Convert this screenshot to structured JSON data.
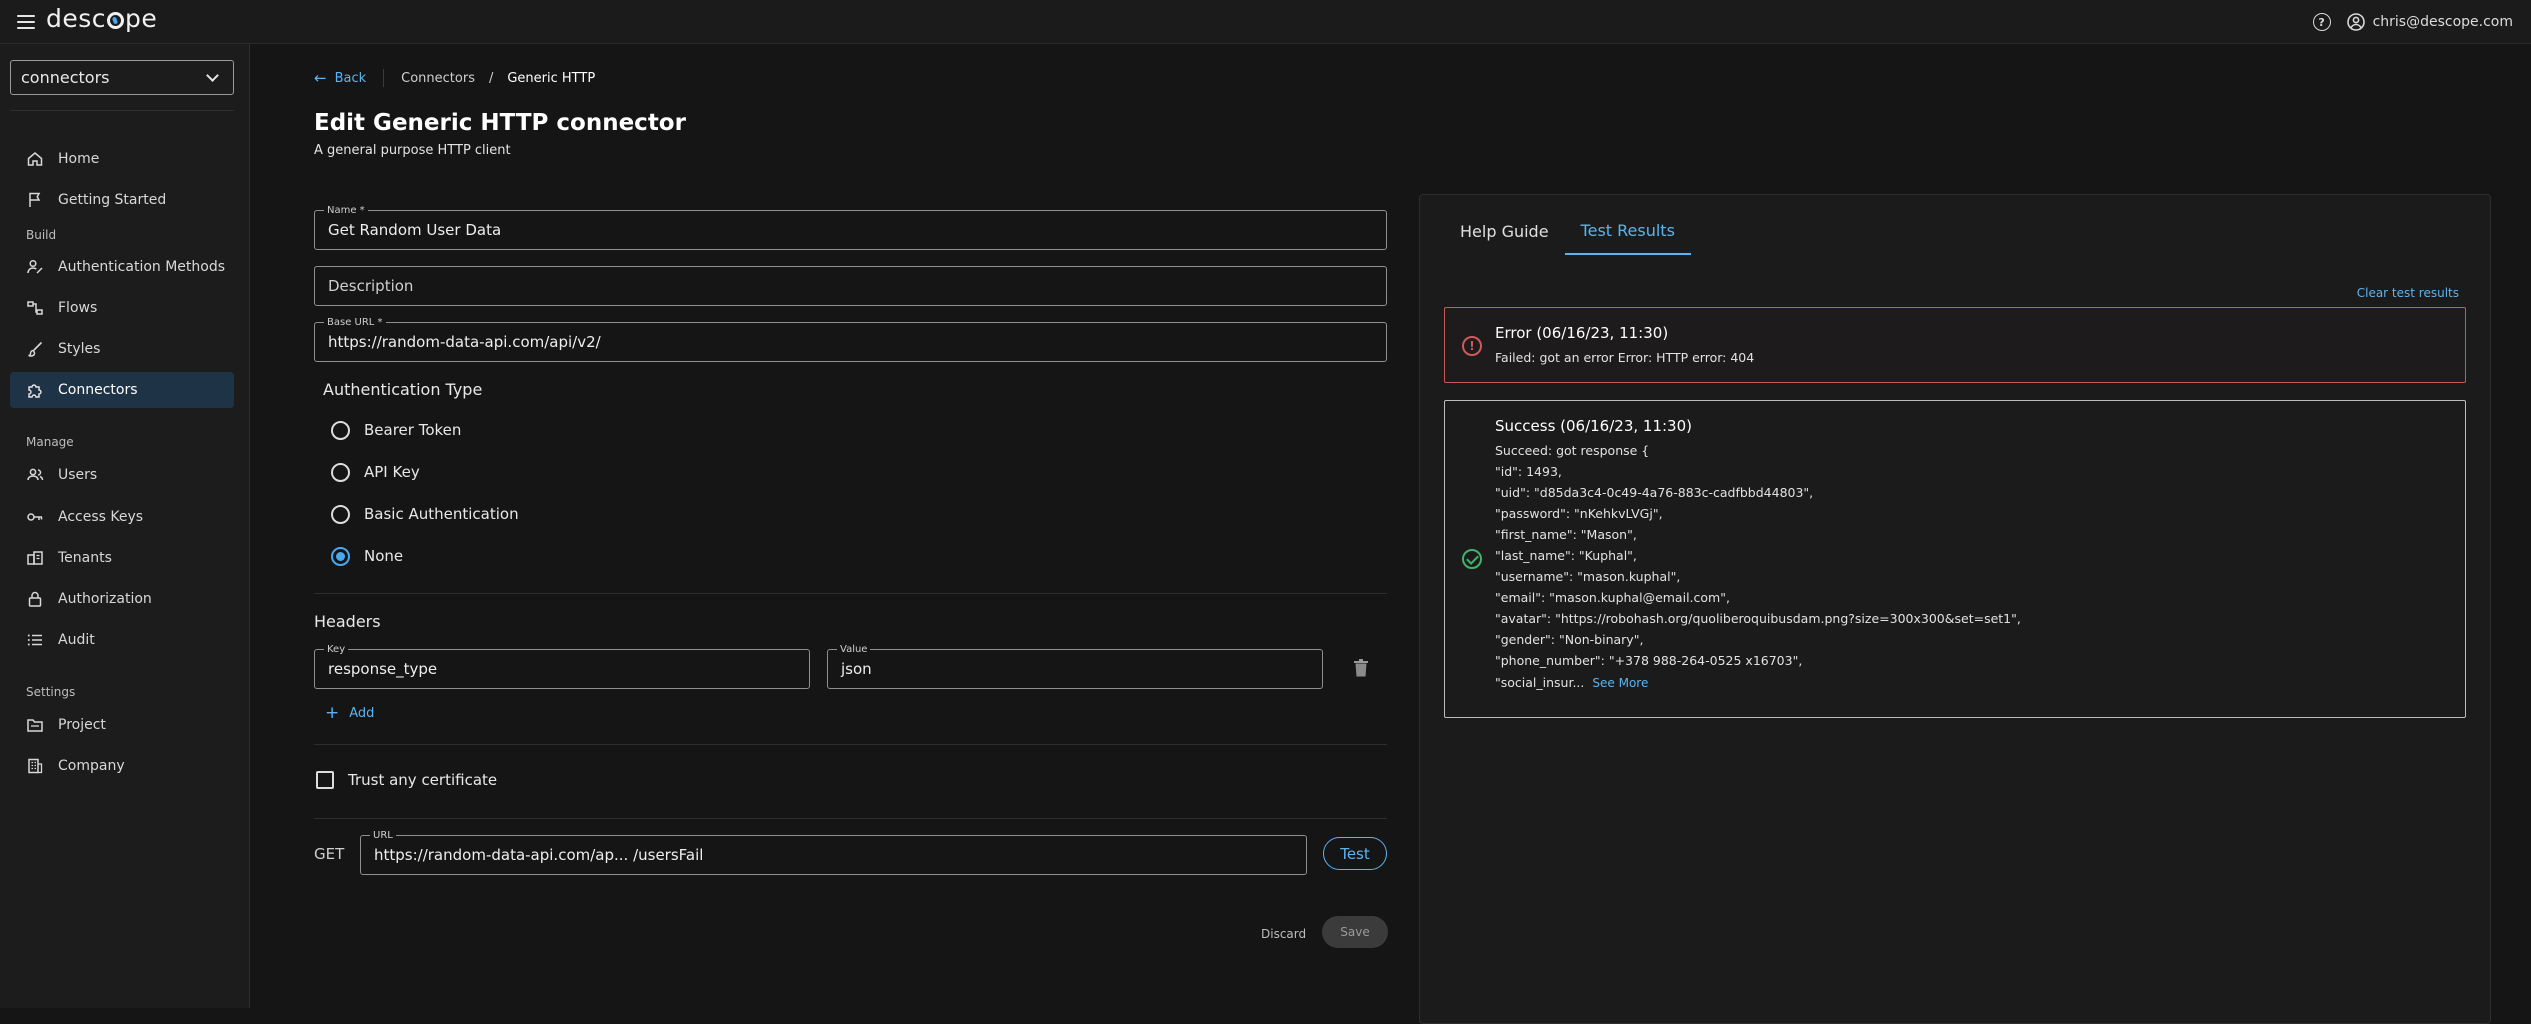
{
  "topbar": {
    "logo": "desc",
    "logo_rest": "pe",
    "user_email": "chris@descope.com",
    "help_icon": "help-circle-icon",
    "user_icon": "user-circle-icon"
  },
  "sidebar": {
    "project": "connectors",
    "items_top": [
      {
        "label": "Home",
        "icon": "home-icon"
      },
      {
        "label": "Getting Started",
        "icon": "flag-icon"
      }
    ],
    "build_label": "Build",
    "items_build": [
      {
        "label": "Authentication Methods",
        "icon": "auth-methods-icon"
      },
      {
        "label": "Flows",
        "icon": "flows-icon"
      },
      {
        "label": "Styles",
        "icon": "brush-icon"
      },
      {
        "label": "Connectors",
        "icon": "puzzle-icon",
        "active": true
      }
    ],
    "manage_label": "Manage",
    "items_manage": [
      {
        "label": "Users",
        "icon": "users-icon"
      },
      {
        "label": "Access Keys",
        "icon": "key-icon"
      },
      {
        "label": "Tenants",
        "icon": "tenants-icon"
      },
      {
        "label": "Authorization",
        "icon": "lock-icon"
      },
      {
        "label": "Audit",
        "icon": "list-icon"
      }
    ],
    "settings_label": "Settings",
    "items_settings": [
      {
        "label": "Project",
        "icon": "folder-icon"
      },
      {
        "label": "Company",
        "icon": "building-icon"
      }
    ]
  },
  "breadcrumb": {
    "back": "Back",
    "parent": "Connectors",
    "separator": "/",
    "current": "Generic HTTP"
  },
  "page": {
    "title": "Edit Generic HTTP connector",
    "subtitle": "A general purpose HTTP client"
  },
  "form": {
    "name_label": "Name *",
    "name_value": "Get Random User Data",
    "description_placeholder": "Description",
    "base_url_label": "Base URL *",
    "base_url_value": "https://random-data-api.com/api/v2/",
    "auth_title": "Authentication Type",
    "auth_options": [
      "Bearer Token",
      "API Key",
      "Basic Authentication",
      "None"
    ],
    "auth_selected": "None",
    "headers_title": "Headers",
    "header_key_label": "Key",
    "header_key_value": "response_type",
    "header_value_label": "Value",
    "header_value_value": "json",
    "add_label": "Add",
    "trust_label": "Trust any certificate",
    "method": "GET",
    "url_label": "URL",
    "url_value": "https://random-data-api.com/ap...  /usersFail",
    "test_label": "Test",
    "discard_label": "Discard",
    "save_label": "Save"
  },
  "panel": {
    "tabs": [
      "Help Guide",
      "Test Results"
    ],
    "active_tab": "Test Results",
    "clear_label": "Clear test results",
    "error": {
      "title": "Error (06/16/23, 11:30)",
      "message": "Failed: got an error Error: HTTP error: 404"
    },
    "success": {
      "title": "Success (06/16/23, 11:30)",
      "lines": [
        "Succeed: got response {",
        "\"id\": 1493,",
        "\"uid\": \"d85da3c4-0c49-4a76-883c-cadfbbd44803\",",
        "\"password\": \"nKehkvLVGj\",",
        "\"first_name\": \"Mason\",",
        "\"last_name\": \"Kuphal\",",
        "\"username\": \"mason.kuphal\",",
        "\"email\": \"mason.kuphal@email.com\",",
        "\"avatar\": \"https://robohash.org/quoliberoquibusdam.png?size=300x300&set=set1\",",
        "\"gender\": \"Non-binary\",",
        "\"phone_number\": \"+378 988-264-0525 x16703\","
      ],
      "last_line": "\"social_insur...",
      "see_more": "See More"
    }
  }
}
